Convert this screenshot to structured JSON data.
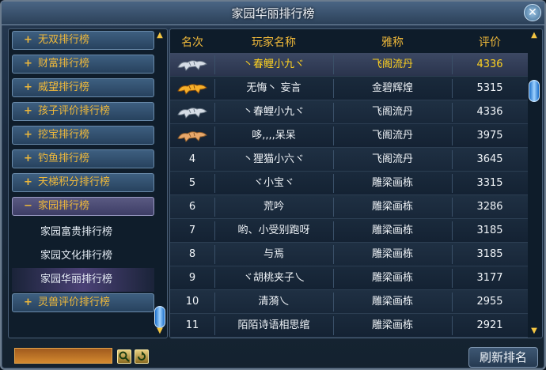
{
  "window": {
    "title": "家园华丽排行榜",
    "close_label": "✕"
  },
  "categories": [
    {
      "sign": "+",
      "label": "无双排行榜"
    },
    {
      "sign": "+",
      "label": "财富排行榜"
    },
    {
      "sign": "+",
      "label": "威望排行榜"
    },
    {
      "sign": "+",
      "label": "孩子评价排行榜"
    },
    {
      "sign": "+",
      "label": "挖宝排行榜"
    },
    {
      "sign": "+",
      "label": "钓鱼排行榜"
    },
    {
      "sign": "+",
      "label": "天梯积分排行榜"
    },
    {
      "sign": "−",
      "label": "家园排行榜"
    }
  ],
  "subitems": [
    {
      "label": "家园富贵排行榜"
    },
    {
      "label": "家园文化排行榜"
    },
    {
      "label": "家园华丽排行榜"
    }
  ],
  "last_category": {
    "sign": "+",
    "label": "灵兽评价排行榜"
  },
  "table": {
    "headers": {
      "rank": "名次",
      "name": "玩家名称",
      "title": "雅称",
      "score": "评价"
    },
    "rows": [
      {
        "rank": "",
        "medal": "silver",
        "name": "丶春鲤小九ヾ",
        "title": "飞阁流丹",
        "score": "4336"
      },
      {
        "rank": "",
        "medal": "gold",
        "name": "无悔丶 妄言",
        "title": "金碧辉煌",
        "score": "5315"
      },
      {
        "rank": "",
        "medal": "silver",
        "name": "丶春鲤小九ヾ",
        "title": "飞阁流丹",
        "score": "4336"
      },
      {
        "rank": "",
        "medal": "bronze",
        "name": "哆,,,,呆呆",
        "title": "飞阁流丹",
        "score": "3975"
      },
      {
        "rank": "4",
        "name": "丶狸猫小六ヾ",
        "title": "飞阁流丹",
        "score": "3645"
      },
      {
        "rank": "5",
        "name": "ヾ小宝ヾ",
        "title": "雕梁画栋",
        "score": "3315"
      },
      {
        "rank": "6",
        "name": "荒吟",
        "title": "雕梁画栋",
        "score": "3286"
      },
      {
        "rank": "7",
        "name": "哟、小受别跑呀",
        "title": "雕梁画栋",
        "score": "3185"
      },
      {
        "rank": "8",
        "name": "与焉",
        "title": "雕梁画栋",
        "score": "3185"
      },
      {
        "rank": "9",
        "name": "ヾ胡桃夹子乀",
        "title": "雕梁画栋",
        "score": "3177"
      },
      {
        "rank": "10",
        "name": "清漪乀",
        "title": "雕梁画栋",
        "score": "2955"
      },
      {
        "rank": "11",
        "name": "陌陌诗语相思绾",
        "title": "雕梁画栋",
        "score": "2921"
      }
    ]
  },
  "bottom": {
    "search_value": "",
    "search_icon": "magnifier-icon",
    "reset_icon": "refresh-arrow-icon",
    "refresh_label": "刷新排名"
  },
  "colors": {
    "gold": "#f0b93a",
    "highlight": "#ffd21f",
    "scroll_thumb": "#5aaaf0"
  }
}
